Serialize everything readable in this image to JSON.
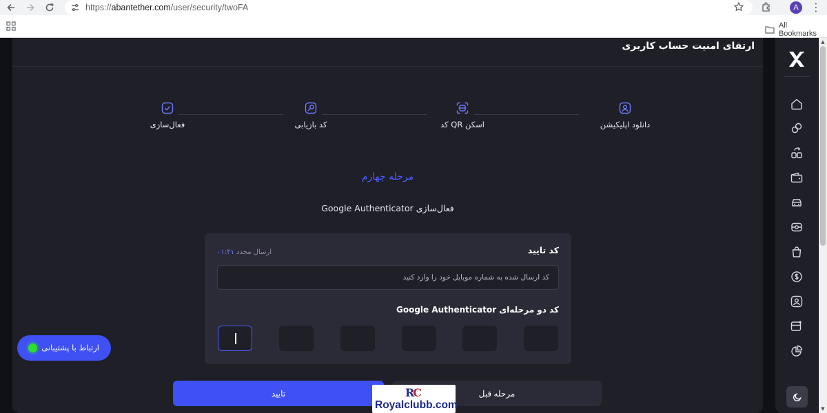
{
  "browser": {
    "url_host": "abantether.com",
    "url_scheme": "https://",
    "url_path": "/user/security/twoFA",
    "profile_initial": "A",
    "bookmarks_label": "All Bookmarks"
  },
  "page": {
    "title": "ارتقای امنیت حساب کاربری"
  },
  "stepper": {
    "steps": [
      {
        "label": "دانلود اپلیکیشن",
        "icon": "user-icon"
      },
      {
        "label": "اسکن QR کد",
        "icon": "scan-icon"
      },
      {
        "label": "کد بازیابی",
        "icon": "key-icon"
      },
      {
        "label": "فعال‌سازی",
        "icon": "check-icon"
      }
    ]
  },
  "stage": {
    "title": "مرحله چهارم",
    "subtitle": "فعال‌سازی Google Authenticator"
  },
  "form": {
    "confirm_label": "کد تایید",
    "resend_label": "ارسال مجدد",
    "resend_timer": "۰۱:۴۱",
    "code_placeholder": "کد ارسال شده به شماره موبایل خود را وارد کنید",
    "twofa_label": "کد دو مرحله‌ای Google Authenticator",
    "otp_digits": [
      "",
      "",
      "",
      "",
      "",
      ""
    ]
  },
  "actions": {
    "confirm": "تایید",
    "previous": "مرحله قبل"
  },
  "support": {
    "label": "ارتباط با پشتیبانی",
    "status_color": "#2ee02e"
  },
  "sidebar": {
    "logo": "X",
    "items": [
      "home-icon",
      "exchange-icon",
      "trade-icon",
      "wallet-icon",
      "car-icon",
      "gift-icon",
      "bag-icon",
      "dollar-icon",
      "profile-icon",
      "card-icon",
      "chart-icon"
    ],
    "theme_icon": "moon-icon"
  },
  "watermark": {
    "mark": "RC",
    "text": "Royalclubb.com"
  },
  "colors": {
    "accent": "#3f51f4",
    "accent_text": "#4f5dff",
    "panel": "#2a2b36",
    "background": "#1e1f27"
  }
}
